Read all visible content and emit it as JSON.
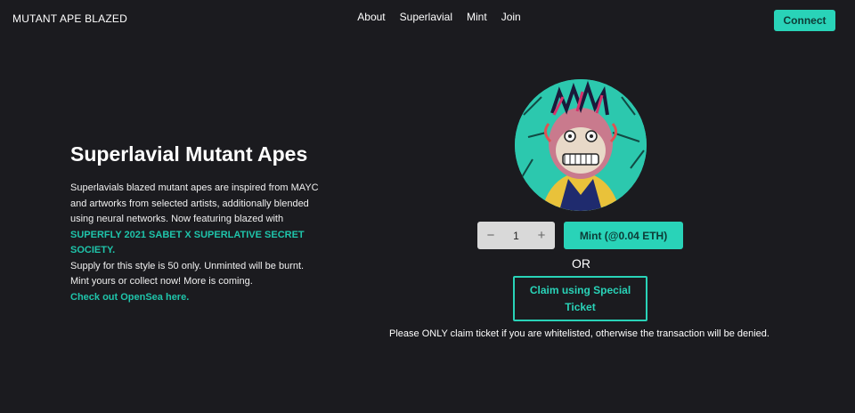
{
  "header": {
    "brand": "MUTANT APE BLAZED",
    "nav": [
      "About",
      "Superlavial",
      "Mint",
      "Join"
    ],
    "connect_label": "Connect"
  },
  "hero": {
    "title": "Superlavial Mutant Apes",
    "description": "Superlavials blazed mutant apes are inspired from MAYC and artworks from selected artists, additionally blended using neural networks. Now featuring blazed with",
    "highlight": "SUPERFLY 2021 SABET X SUPERLATIVE SECRET SOCIETY.",
    "supply_text": "Supply for this style is 50 only. Unminted will be burnt.",
    "cta_text": "Mint yours or collect now! More is coming.",
    "opensea_link": "Check out OpenSea here."
  },
  "mint": {
    "decrement_symbol": "−",
    "quantity": "1",
    "increment_symbol": "+",
    "mint_label": "Mint (@0.04 ETH)",
    "or_label": "OR",
    "claim_label": "Claim using Special Ticket",
    "note": "Please ONLY claim ticket if you are whitelisted, otherwise the transaction will be denied."
  },
  "colors": {
    "background": "#1b1b1f",
    "accent": "#29d3b8",
    "stepper_bg": "#d9d9d9"
  },
  "icons": {
    "avatar": "ape-nft-avatar-icon"
  }
}
